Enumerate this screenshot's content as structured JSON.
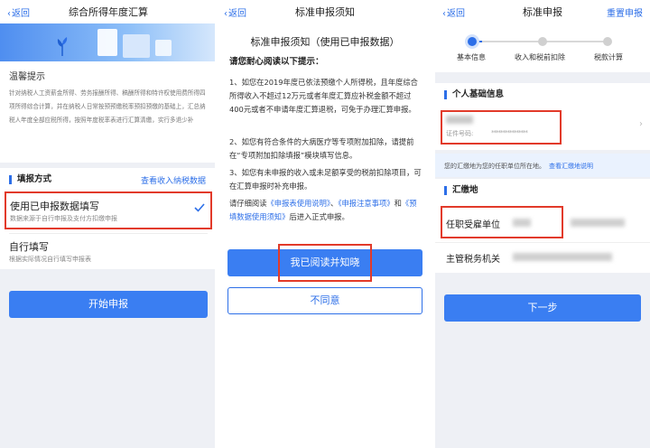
{
  "colors": {
    "accent": "#3a7ef2",
    "highlight_frame": "#e23a2a",
    "background": "#eef0f5"
  },
  "panel1": {
    "back_label": "返回",
    "title": "综合所得年度汇算",
    "tips_title": "温馨提示",
    "tips_text": "针对纳税人工资薪金所得、劳务报酬所得、稿酬所得和特许权使用费所得四项所得综合计算，并在纳税人日常按预预缴税率预扣预缴的基础上，汇总纳税人年度全部应税所得，按照年度税率表进行汇算清缴，实行多退少补",
    "section_title": "填报方式",
    "section_link": "查看收入纳税数据",
    "option1_title": "使用已申报数据填写",
    "option1_desc": "数据来源于自行申报及支付方扣缴申报",
    "option2_title": "自行填写",
    "option2_desc": "根据实际情况自行填写申报表",
    "start_button": "开始申报",
    "check_icon": "check-icon"
  },
  "panel2": {
    "back_label": "返回",
    "title": "标准申报须知",
    "notice_title": "标准申报须知（使用已申报数据）",
    "notice_sub": "请您耐心阅读以下提示：",
    "para1": "1、如您在2019年度已依法预缴个人所得税，且年度综合所得收入不超过12万元或者年度汇算应补税金额不超过400元或者不申请年度汇算退税，可免于办理汇算申报。",
    "para2": "2、如您有符合条件的大病医疗等专项附加扣除，请提前在“专项附加扣除填报”模块填写信息。",
    "para3": "3、如您有未申报的收入或未足额享受的税前扣除项目，可在汇算申报时补充申报。",
    "para4_pre": "请仔细阅读",
    "para4_link1": "《申报表使用说明》",
    "para4_sep1": "、",
    "para4_link2": "《申报注意事项》",
    "para4_sep2": "和",
    "para4_link3": "《预填数据使用须知》",
    "para4_post": "后进入正式申报。",
    "agree_button": "我已阅读并知晓",
    "disagree_button": "不同意"
  },
  "panel3": {
    "back_label": "返回",
    "title": "标准申报",
    "reset_label": "重置申报",
    "steps": [
      "基本信息",
      "收入和税前扣除",
      "税款计算"
    ],
    "info_section": "个人基础信息",
    "id_label": "证件号码:",
    "id_mask": "****************",
    "note_text": "您的汇缴地为您的任职单位所在地。",
    "note_link": "查看汇缴地说明",
    "pay_section": "汇缴地",
    "employer_label": "任职受雇单位",
    "tax_office_label": "主管税务机关",
    "next_button": "下一步"
  }
}
